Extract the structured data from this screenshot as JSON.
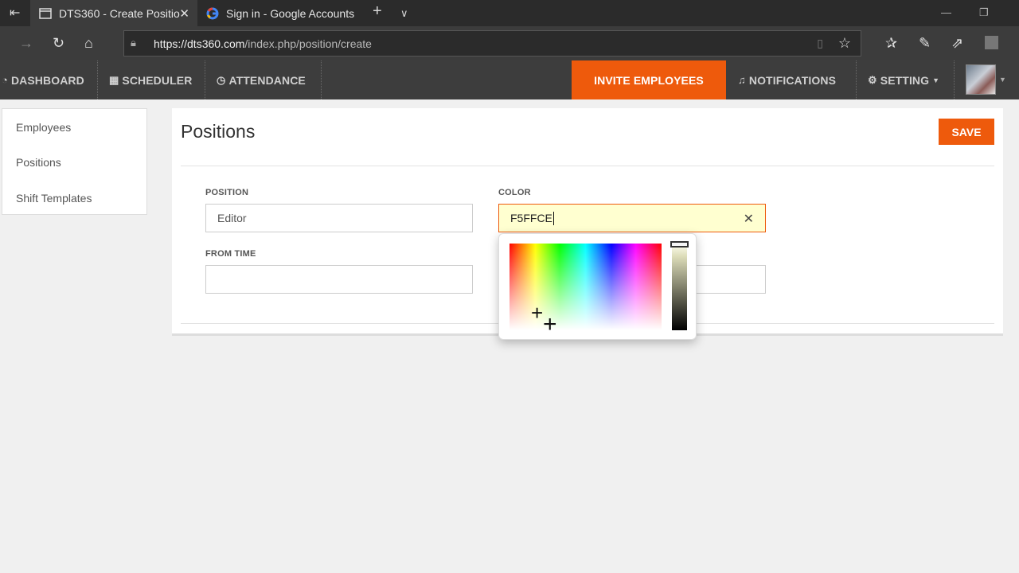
{
  "browser": {
    "tabs": [
      {
        "title": "DTS360 - Create Positio",
        "active": true
      },
      {
        "title": "Sign in - Google Accounts",
        "active": false
      }
    ],
    "url_host": "https://dts360.com",
    "url_path": "/index.php/position/create"
  },
  "nav": {
    "dashboard": "DASHBOARD",
    "scheduler": "SCHEDULER",
    "attendance": "ATTENDANCE",
    "invite": "INVITE EMPLOYEES",
    "notifications": "NOTIFICATIONS",
    "setting": "SETTING"
  },
  "sidebar": {
    "items": [
      "Employees",
      "Positions",
      "Shift Templates"
    ]
  },
  "page": {
    "title": "Positions",
    "save_label": "SAVE"
  },
  "form": {
    "position_label": "POSITION",
    "position_value": "Editor",
    "color_label": "COLOR",
    "color_value": "F5FFCE",
    "from_time_label": "FROM TIME",
    "from_time_value": "",
    "to_time_value": ""
  },
  "colors": {
    "accent": "#ee5a0c",
    "nav_bg": "#3d3d3d",
    "active_field_bg": "#ffffd0"
  }
}
